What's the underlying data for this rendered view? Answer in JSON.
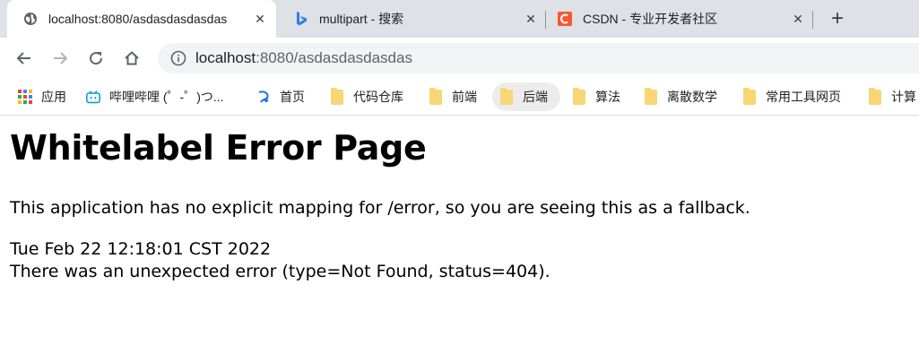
{
  "tabs": [
    {
      "title": "localhost:8080/asdasdasdasdas",
      "close": "✕",
      "icon": "globe-icon"
    },
    {
      "title": "multipart - 搜索",
      "close": "✕",
      "icon": "bing-icon"
    },
    {
      "title": "CSDN - 专业开发者社区",
      "close": "✕",
      "icon": "csdn-icon"
    }
  ],
  "new_tab": "+",
  "address_bar": {
    "host": "localhost",
    "path": ":8080/asdasdasdasdas",
    "icon": "info-icon"
  },
  "bookmarks": [
    {
      "label": "应用",
      "icon": "apps-grid-icon"
    },
    {
      "label": "哔哩哔哩 (゜-゜)つ...",
      "icon": "bilibili-icon"
    },
    {
      "label": "首页",
      "icon": "site-icon"
    },
    {
      "label": "代码仓库",
      "icon": "folder-icon"
    },
    {
      "label": "前端",
      "icon": "folder-icon"
    },
    {
      "label": "后端",
      "icon": "folder-icon"
    },
    {
      "label": "算法",
      "icon": "folder-icon"
    },
    {
      "label": "离散数学",
      "icon": "folder-icon"
    },
    {
      "label": "常用工具网页",
      "icon": "folder-icon"
    },
    {
      "label": "计算",
      "icon": "folder-icon"
    }
  ],
  "page": {
    "heading": "Whitelabel Error Page",
    "message": "This application has no explicit mapping for /error, so you are seeing this as a fallback.",
    "timestamp": "Tue Feb 22 12:18:01 CST 2022",
    "error": "There was an unexpected error (type=Not Found, status=404)."
  },
  "colors": {
    "tab_strip": "#dee1e6",
    "omnibox": "#f1f3f4",
    "csdn": "#fc5531",
    "bing": "#2f7ee6"
  }
}
